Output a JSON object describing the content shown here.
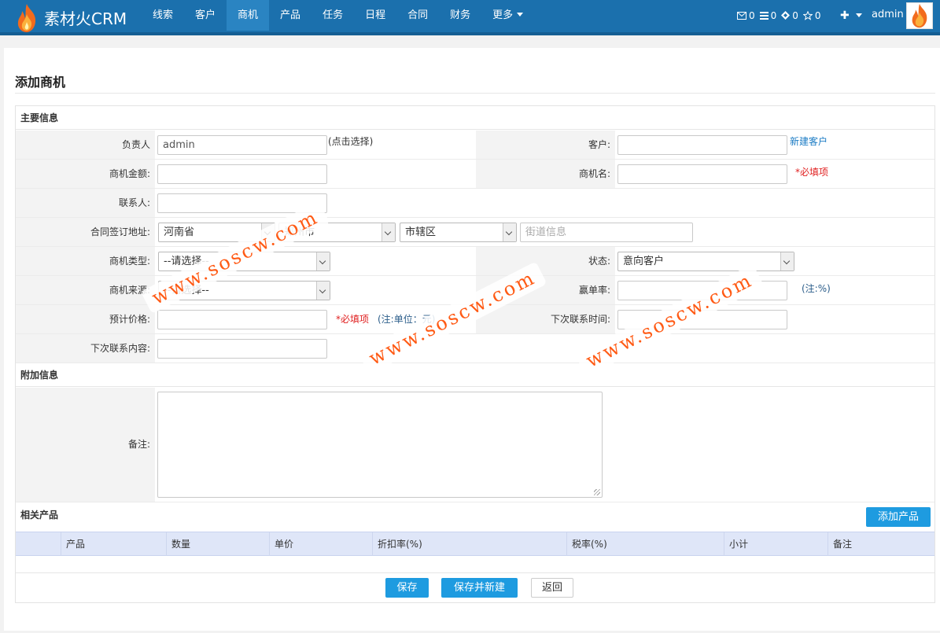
{
  "app": {
    "brand": "素材火CRM",
    "user": "admin"
  },
  "nav": [
    "线索",
    "客户",
    "商机",
    "产品",
    "任务",
    "日程",
    "合同",
    "财务",
    "更多"
  ],
  "nav_active": "商机",
  "counters": {
    "mail": "0",
    "list": "0",
    "diamond": "0",
    "star": "0"
  },
  "page": {
    "title": "添加商机"
  },
  "sections": {
    "main": "主要信息",
    "extra": "附加信息",
    "products": "相关产品"
  },
  "form": {
    "owner_label": "负责人",
    "owner_value": "admin",
    "owner_hint": "(点击选择)",
    "customer_label": "客户:",
    "customer_link": "新建客户",
    "amount_label": "商机金额:",
    "name_label": "商机名:",
    "required": "*必填项",
    "contact_label": "联系人:",
    "address_label": "合同签订地址:",
    "province": "河南省",
    "city": "郑州市",
    "district": "市辖区",
    "street_placeholder": "街道信息",
    "type_label": "商机类型:",
    "type_value": "--请选择--",
    "status_label": "状态:",
    "status_value": "意向客户",
    "source_label": "商机来源:",
    "source_value": "--请选择--",
    "win_label": "赢单率:",
    "win_note": "(注:%)",
    "price_label": "预计价格:",
    "price_required": "*必填项",
    "price_note": "(注:单位：元)",
    "next_time_label": "下次联系时间:",
    "next_content_label": "下次联系内容:",
    "remark_label": "备注:"
  },
  "products": {
    "add_button": "添加产品",
    "columns": [
      "产品",
      "数量",
      "单价",
      "折扣率(%)",
      "税率(%)",
      "小计",
      "备注"
    ]
  },
  "actions": {
    "save": "保存",
    "save_new": "保存并新建",
    "back": "返回"
  },
  "watermark": "www.soscw.com",
  "colors": {
    "topbar": "#1b70ad",
    "accent": "#1e9be0",
    "required": "#e02020",
    "watermark": "#ff5a14"
  }
}
